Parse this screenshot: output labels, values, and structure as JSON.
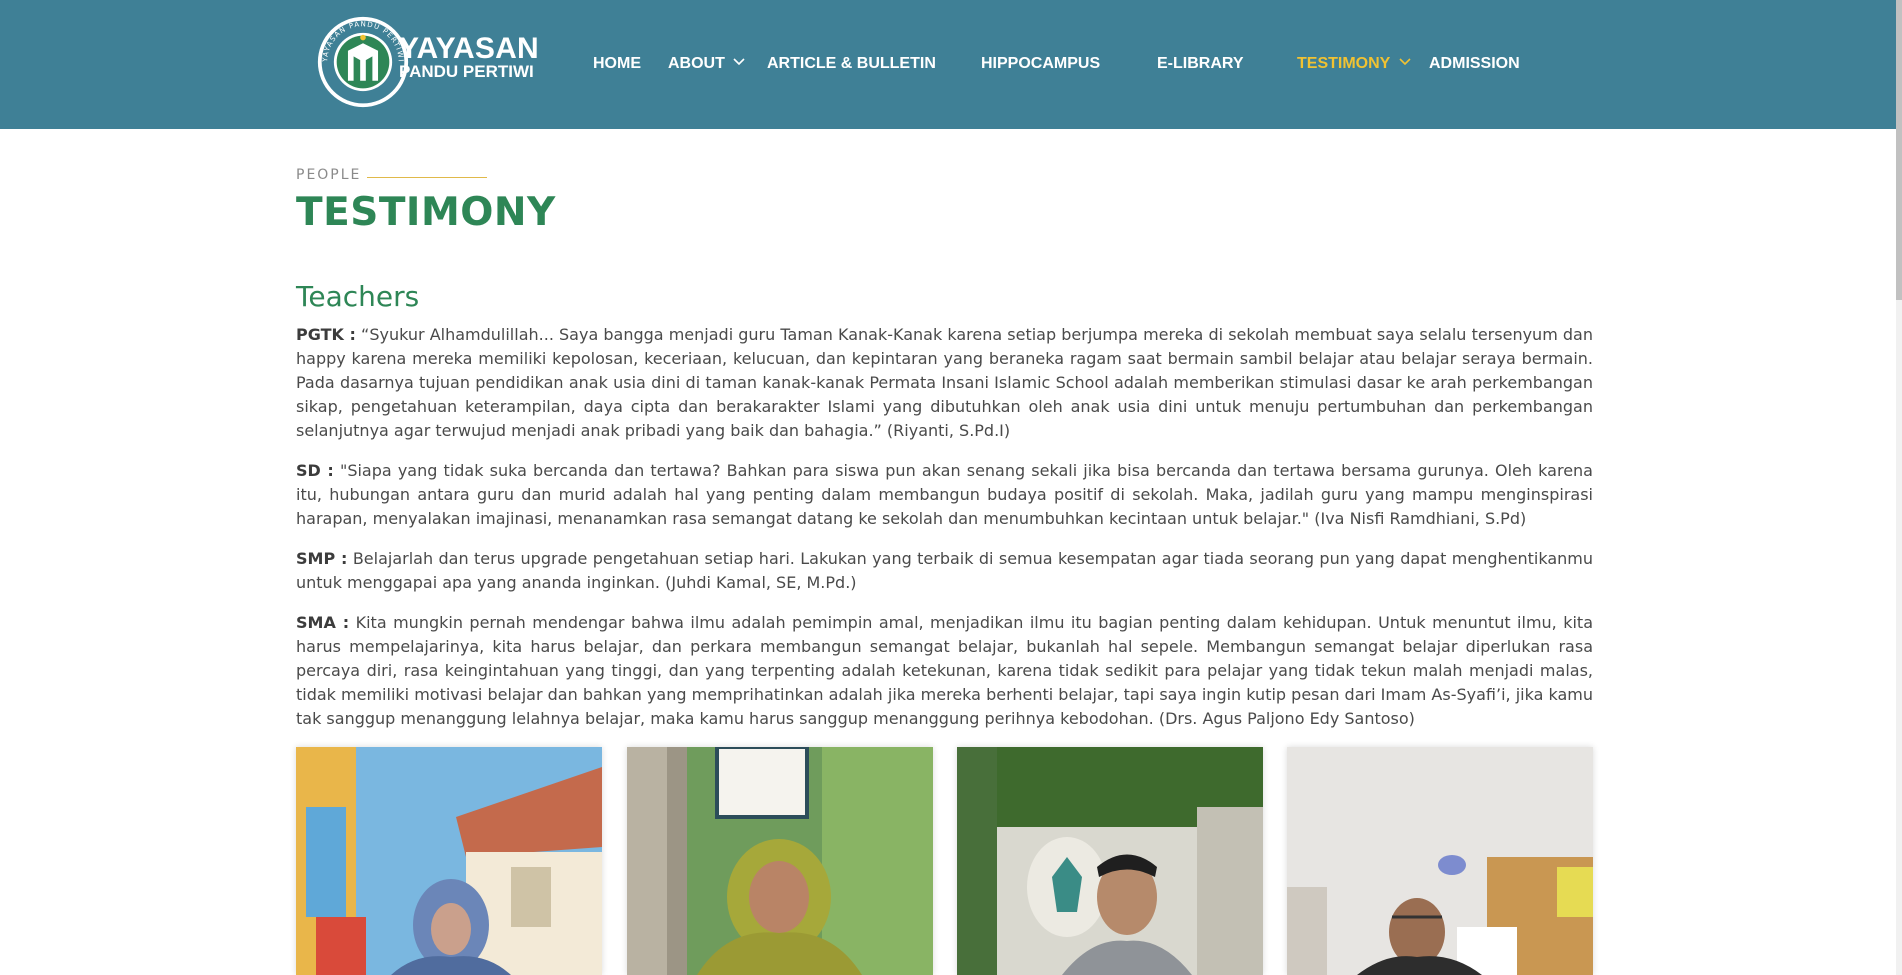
{
  "header": {
    "brand_line1": "YAYASAN",
    "brand_line2": "PANDU PERTIWI",
    "logo_ring_text": "YAYASAN PANDU PERTIWI",
    "bg_color": "#3f8096",
    "active_color": "#f1c232"
  },
  "nav": {
    "home": "HOME",
    "about": "ABOUT",
    "article": "ARTICLE & BULLETIN",
    "hippocampus": "HIPPOCAMPUS",
    "elibrary": "E-LIBRARY",
    "testimony": "TESTIMONY",
    "admission": "ADMISSION"
  },
  "page": {
    "eyebrow": "PEOPLE",
    "title": "TESTIMONY",
    "section_title": "Teachers"
  },
  "testimonials": [
    {
      "level": "PGTK :",
      "text": " “Syukur Alhamdulillah... Saya bangga menjadi guru Taman Kanak-Kanak karena setiap berjumpa mereka di sekolah membuat saya selalu tersenyum dan happy karena mereka memiliki kepolosan, keceriaan, kelucuan, dan kepintaran yang beraneka ragam saat bermain sambil belajar atau belajar seraya bermain. Pada dasarnya tujuan pendidikan anak usia dini di taman kanak-kanak Permata Insani Islamic School adalah memberikan stimulasi dasar ke arah perkembangan sikap, pengetahuan keterampilan, daya cipta dan berakarakter Islami yang dibutuhkan oleh anak usia dini untuk menuju pertumbuhan dan perkembangan selanjutnya agar terwujud menjadi anak pribadi yang baik dan bahagia.” (Riyanti, S.Pd.I)"
    },
    {
      "level": "SD :",
      "text": " \"Siapa yang tidak suka bercanda dan tertawa? Bahkan para siswa pun akan senang sekali jika bisa bercanda dan tertawa bersama gurunya. Oleh karena itu, hubungan antara guru dan murid adalah hal yang penting dalam membangun budaya positif di sekolah. Maka, jadilah guru yang mampu menginspirasi harapan, menyalakan imajinasi, menanamkan rasa semangat datang ke sekolah dan menumbuhkan kecintaan untuk belajar.\" (Iva Nisfi Ramdhiani, S.Pd)"
    },
    {
      "level": "SMP :",
      "text": " Belajarlah dan terus upgrade pengetahuan setiap hari. Lakukan yang terbaik di semua kesempatan agar tiada seorang pun yang dapat menghentikanmu untuk menggapai apa yang ananda inginkan. (Juhdi Kamal, SE, M.Pd.)"
    },
    {
      "level": "SMA :",
      "text": " Kita mungkin pernah mendengar bahwa ilmu adalah pemimpin amal, menjadikan ilmu itu bagian penting dalam kehidupan. Untuk menuntut ilmu, kita harus mempelajarinya, kita harus belajar, dan perkara membangun semangat belajar, bukanlah hal sepele. Membangun semangat belajar diperlukan rasa percaya diri, rasa keingintahuan yang tinggi, dan yang terpenting adalah ketekunan, karena tidak sedikit para pelajar yang tidak tekun malah menjadi malas, tidak memiliki motivasi belajar dan bahkan yang memprihatinkan adalah jika mereka berhenti belajar, tapi saya ingin kutip pesan dari Imam As-Syafi’i, jika kamu tak sanggup menanggung lelahnya belajar, maka kamu harus sanggup menanggung perihnya kebodohan. (Drs. Agus Paljono Edy Santoso)"
    }
  ],
  "colors": {
    "heading_green": "#2e8656",
    "eyebrow_line": "#e0b94a"
  }
}
